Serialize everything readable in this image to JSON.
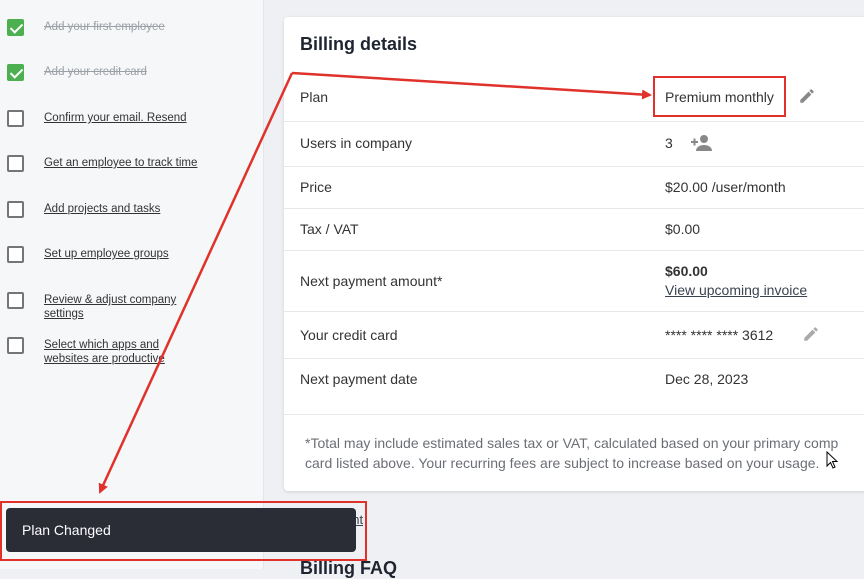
{
  "checklist": [
    {
      "label": "Add your first employee",
      "done": true
    },
    {
      "label": "Add your credit card",
      "done": true
    },
    {
      "label": "Confirm your email. Resend",
      "done": false
    },
    {
      "label": "Get an employee to track time",
      "done": false
    },
    {
      "label": "Add projects and tasks",
      "done": false
    },
    {
      "label": "Set up employee groups",
      "done": false
    },
    {
      "label": "Review & adjust company settings",
      "done": false
    },
    {
      "label": "Select which apps and websites are productive",
      "done": false
    }
  ],
  "billing": {
    "title": "Billing details",
    "rows": [
      {
        "label": "Plan",
        "value": "Premium monthly"
      },
      {
        "label": "Users in company",
        "value": "3"
      },
      {
        "label": "Price",
        "value": "$20.00 /user/month"
      },
      {
        "label": "Tax / VAT",
        "value": "$0.00"
      },
      {
        "label": "Next payment amount*",
        "value": "$60.00",
        "link": "View upcoming invoice"
      },
      {
        "label": "Your credit card",
        "value": "**** **** **** 3612"
      },
      {
        "label": "Next payment date",
        "value": "Dec 28, 2023"
      }
    ],
    "footnote_line1": "*Total may include estimated sales tax or VAT, calculated based on your primary comp",
    "footnote_line2": "card listed above. Your recurring fees are subject to increase based on your usage."
  },
  "below_link": "unt",
  "faq_title": "Billing FAQ",
  "toast": {
    "message": "Plan Changed"
  },
  "colors": {
    "accent_red": "#e0322b",
    "check_green": "#4caf50",
    "toast_bg": "#2a2c36"
  }
}
